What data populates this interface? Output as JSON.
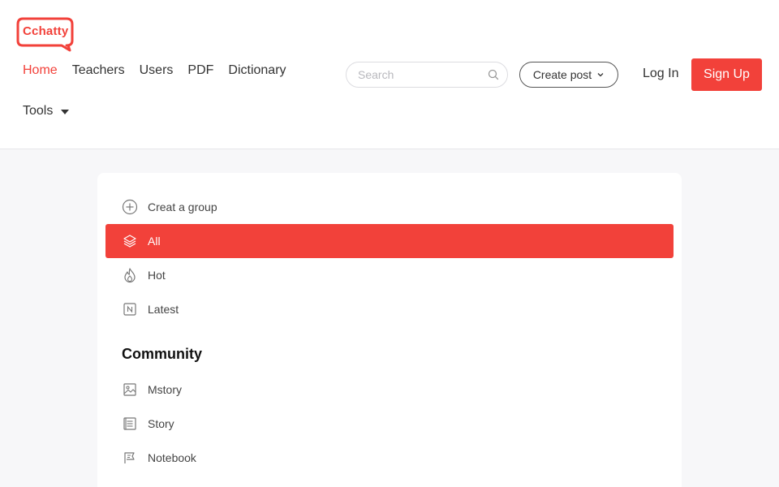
{
  "brand": {
    "logo_text": "Cchatty",
    "accent_color": "#f2413a"
  },
  "nav": {
    "items": [
      {
        "label": "Home",
        "active": true
      },
      {
        "label": "Teachers"
      },
      {
        "label": "Users"
      },
      {
        "label": "PDF"
      },
      {
        "label": "Dictionary"
      }
    ],
    "tools_label": "Tools"
  },
  "search": {
    "placeholder": "Search",
    "value": ""
  },
  "actions": {
    "create_post": "Create post",
    "login": "Log In",
    "signup": "Sign Up"
  },
  "menu": {
    "items": [
      {
        "label": "Creat a group",
        "icon": "plus-circle-icon"
      },
      {
        "label": "All",
        "icon": "layers-icon",
        "active": true
      },
      {
        "label": "Hot",
        "icon": "flame-icon"
      },
      {
        "label": "Latest",
        "icon": "new-badge-icon"
      }
    ],
    "community_title": "Community",
    "community_items": [
      {
        "label": "Mstory",
        "icon": "image-icon"
      },
      {
        "label": "Story",
        "icon": "document-icon"
      },
      {
        "label": "Notebook",
        "icon": "flag-icon"
      }
    ]
  }
}
